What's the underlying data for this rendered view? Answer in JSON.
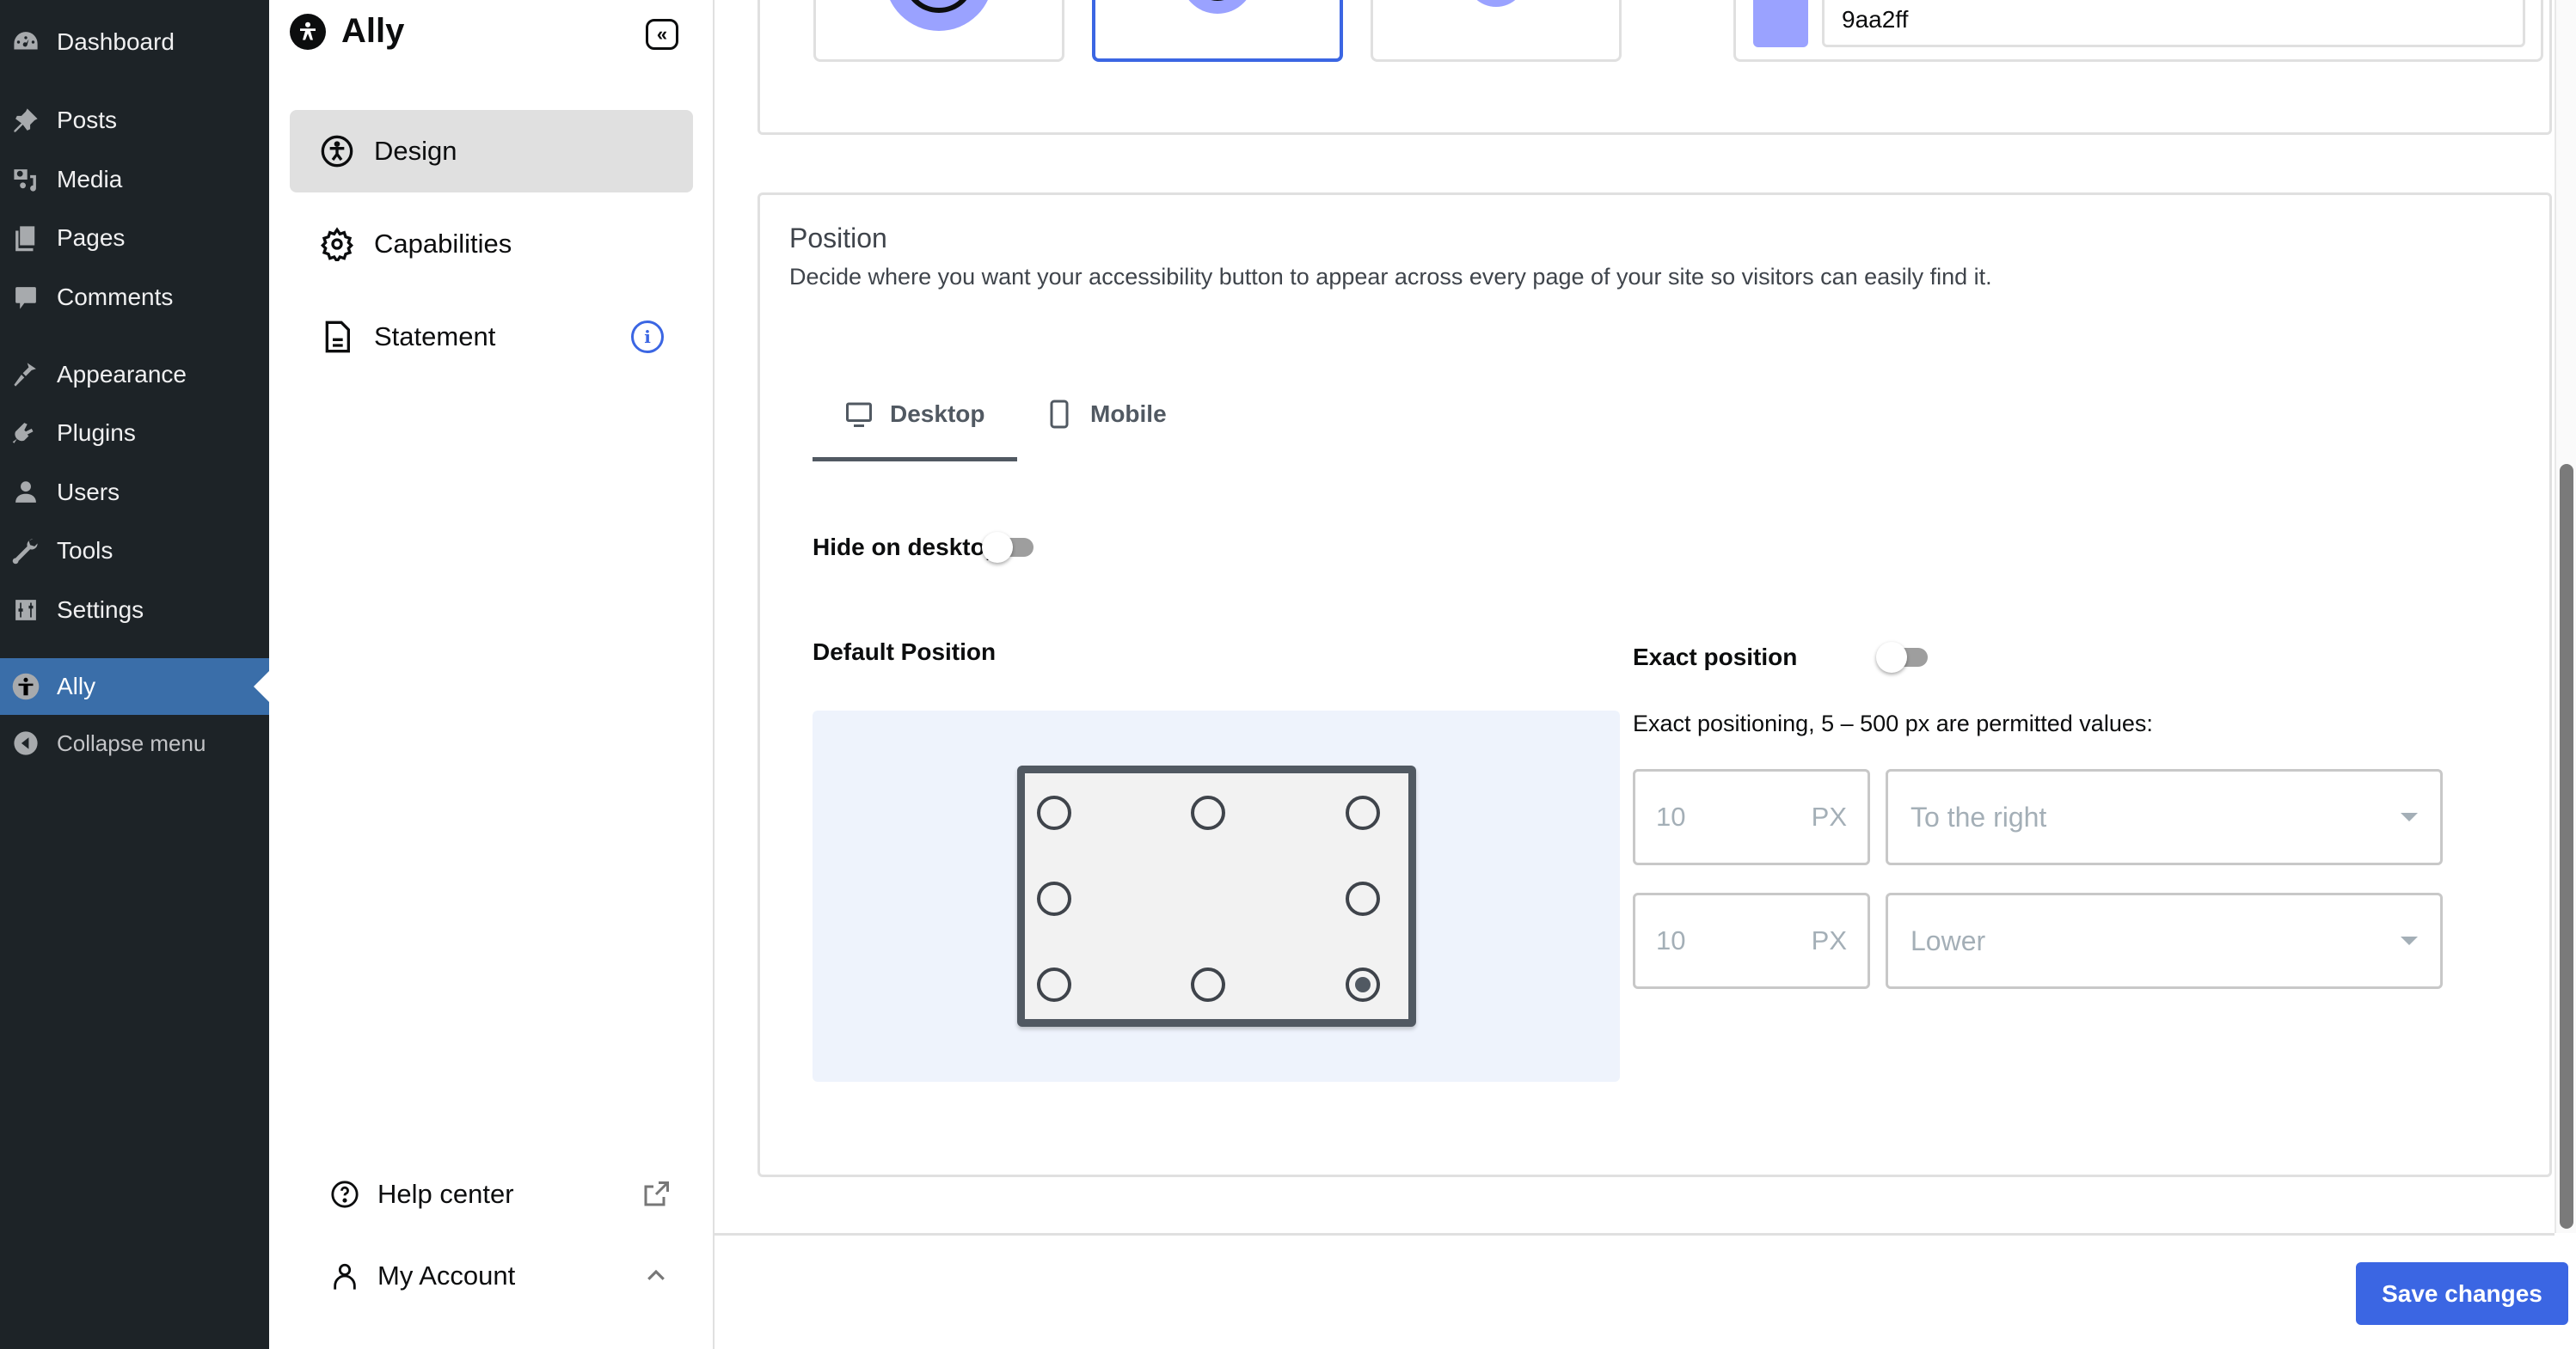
{
  "wp_menu": {
    "items": [
      {
        "label": "Dashboard",
        "icon": "dashboard-icon"
      },
      {
        "label": "Posts",
        "icon": "pin-icon"
      },
      {
        "label": "Media",
        "icon": "media-icon"
      },
      {
        "label": "Pages",
        "icon": "pages-icon"
      },
      {
        "label": "Comments",
        "icon": "comment-icon"
      },
      {
        "label": "Appearance",
        "icon": "brush-icon"
      },
      {
        "label": "Plugins",
        "icon": "plug-icon"
      },
      {
        "label": "Users",
        "icon": "user-icon"
      },
      {
        "label": "Tools",
        "icon": "wrench-icon"
      },
      {
        "label": "Settings",
        "icon": "sliders-icon"
      },
      {
        "label": "Ally",
        "icon": "accessibility-icon",
        "active": true
      }
    ],
    "collapse_label": "Collapse menu"
  },
  "ally_panel": {
    "title": "Ally",
    "nav": [
      {
        "label": "Design",
        "icon": "accessibility-icon",
        "active": true
      },
      {
        "label": "Capabilities",
        "icon": "gear-icon"
      },
      {
        "label": "Statement",
        "icon": "document-icon",
        "badge": "i"
      }
    ],
    "help_center": "Help center",
    "my_account": "My Account"
  },
  "icon_settings": {
    "size_options": [
      "large",
      "medium",
      "small"
    ],
    "selected_size": "medium",
    "color_hex": "9aa2ff",
    "color": "#9aa2ff"
  },
  "position": {
    "title": "Position",
    "description": "Decide where you want your accessibility button to appear across every page of your site so visitors can easily find it.",
    "tabs": [
      {
        "label": "Desktop",
        "icon": "desktop-icon",
        "active": true
      },
      {
        "label": "Mobile",
        "icon": "mobile-icon"
      }
    ],
    "hide_label": "Hide on desktop",
    "hide_enabled": false,
    "default_position_label": "Default Position",
    "grid_positions": [
      "top-left",
      "top-center",
      "top-right",
      "middle-left",
      "middle-right",
      "bottom-left",
      "bottom-center",
      "bottom-right"
    ],
    "selected_position": "bottom-right",
    "exact_label": "Exact position",
    "exact_enabled": false,
    "exact_help": "Exact positioning, 5 – 500 px are permitted values:",
    "horizontal": {
      "value": "10",
      "unit": "PX",
      "direction": "To the right"
    },
    "vertical": {
      "value": "10",
      "unit": "PX",
      "direction": "Lower"
    }
  },
  "footer": {
    "save_label": "Save changes"
  },
  "colors": {
    "accent": "#3b66e3",
    "wp_sidebar": "#1d2327",
    "wp_active": "#3a6ea9"
  }
}
